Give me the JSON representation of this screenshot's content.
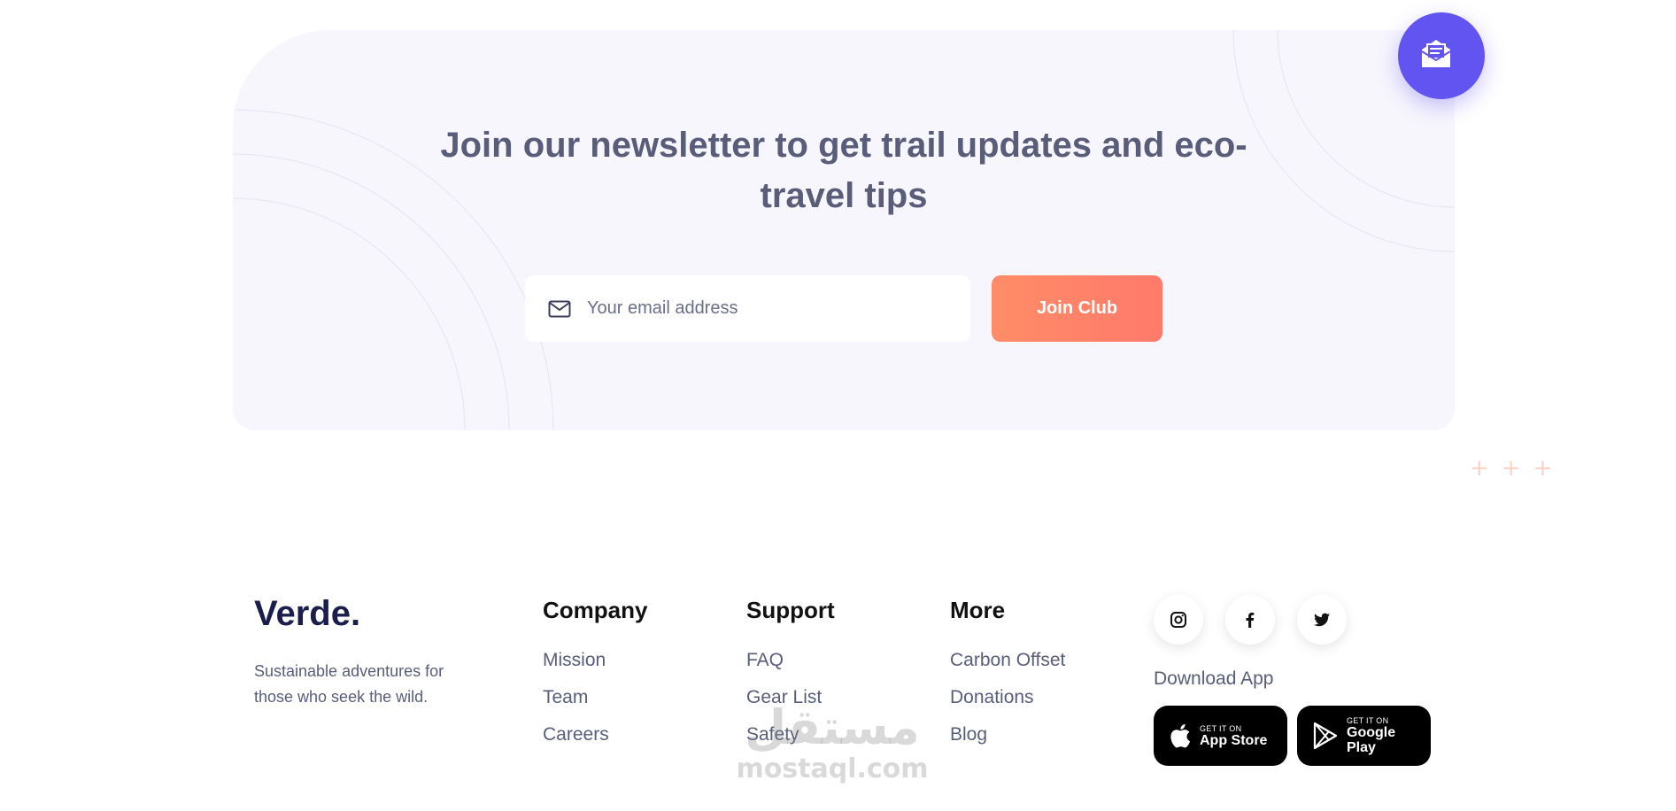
{
  "newsletter": {
    "title": "Join our newsletter to get trail updates and eco-travel tips",
    "email_placeholder": "Your email address",
    "join_label": "Join Club"
  },
  "decor": {
    "plus_signs": [
      "+",
      "+",
      "+"
    ]
  },
  "footer": {
    "brand": "Verde.",
    "tagline": "Sustainable adventures for those who seek the wild.",
    "columns": [
      {
        "heading": "Company",
        "links": [
          "Mission",
          "Team",
          "Careers"
        ]
      },
      {
        "heading": "Support",
        "links": [
          "FAQ",
          "Gear List",
          "Safety"
        ]
      },
      {
        "heading": "More",
        "links": [
          "Carbon Offset",
          "Donations",
          "Blog"
        ]
      }
    ],
    "social": [
      "instagram-icon",
      "facebook-icon",
      "twitter-icon"
    ],
    "download_label": "Download App",
    "app_store": {
      "small": "GET IT ON",
      "big": "App Store"
    },
    "google_play": {
      "small": "GET IT ON",
      "big_line1": "Google",
      "big_line2": "Play"
    }
  },
  "watermark": {
    "arabic": "مستقل",
    "latin": "mostaql.com"
  },
  "colors": {
    "card_bg": "#f7f6fd",
    "title": "#5a5d7a",
    "accent_purple": "#6254f0",
    "cta_orange": "#ff8068",
    "brand_navy": "#1b1e4d",
    "store_black": "#000000"
  }
}
